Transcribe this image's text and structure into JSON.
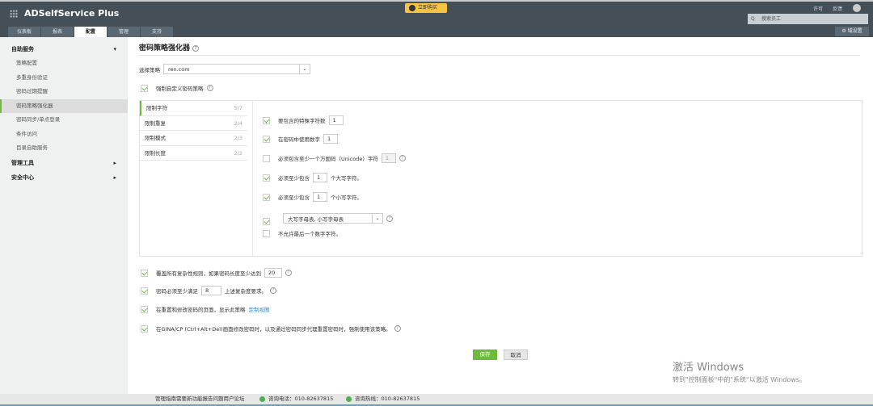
{
  "header": {
    "app_name": "ADSelfService Plus",
    "buy_now": "立即购买",
    "license": "许可",
    "feedback": "反馈",
    "search_placeholder": "搜索员工",
    "domain_settings": "域设置",
    "tabs": [
      {
        "label": "仪表板"
      },
      {
        "label": "报表"
      },
      {
        "label": "配置"
      },
      {
        "label": "管理"
      },
      {
        "label": "支持"
      }
    ],
    "active_tab": "配置"
  },
  "sidebar": {
    "sections": [
      {
        "label": "自助服务",
        "items": [
          "策略配置",
          "多重身份验证",
          "密码过期提醒",
          "密码策略强化器",
          "密码同步/单点登录",
          "条件访问",
          "目录自助服务"
        ]
      },
      {
        "label": "管理工具"
      },
      {
        "label": "安全中心"
      }
    ],
    "active_item": "密码策略强化器"
  },
  "main": {
    "title": "密码策略强化器",
    "select_policy_label": "选择策略",
    "policy_value": "ren.com",
    "enforce_custom": "强制自定义密码策略",
    "rule_tabs": [
      {
        "label": "限制字符",
        "count": "5/7"
      },
      {
        "label": "限制重复",
        "count": "2/4"
      },
      {
        "label": "限制模式",
        "count": "2/3"
      },
      {
        "label": "限制长度",
        "count": "2/2"
      }
    ],
    "rules": {
      "special": {
        "label": "要包含的特殊字符数",
        "value": "1",
        "checked": true
      },
      "digit": {
        "label": "在密码中使用数字",
        "value": "1",
        "checked": true
      },
      "unicode": {
        "label": "必须包含至少一个万国码（Unicode）字符",
        "value": "1",
        "checked": false
      },
      "upper": {
        "label": "必须至少包含",
        "value": "1",
        "suffix": "个大写字符。",
        "checked": true
      },
      "lower": {
        "label": "必须至少包含",
        "value": "1",
        "suffix": "个小写字符。",
        "checked": true
      },
      "start_with": {
        "value": "大写字母表, 小写字母表",
        "checked": true
      },
      "last_digit": {
        "label": "不允许最后一个数字字符。",
        "checked": false
      }
    },
    "override": {
      "label": "覆盖所有复杂性规则，如果密码长度至少达到",
      "value": "20"
    },
    "min_meet": {
      "label": "密码必须至少满足",
      "value": "8",
      "suffix": "上述复杂度要求。"
    },
    "display": {
      "label": "在重置和修改密码的页面，显示此策略",
      "link": "定制视图"
    },
    "gina": {
      "label": "在GINA/CP (Ctrl+Alt+Del)画面修改密码时，以及通过密码同步代理重置密码时，强制使用该策略。"
    },
    "save": "保存",
    "cancel": "取消"
  },
  "footer": {
    "links": "管理指南需要新功能报告问题用户论坛",
    "phone": "咨询电话：010-82637815",
    "hotline": "咨询热线：010-82637815"
  },
  "watermark": {
    "line1": "激活 Windows",
    "line2": "转到\"控制面板\"中的\"系统\"以激活 Windows。"
  },
  "colors": {
    "header": "#444f58",
    "accent": "#6dbb3a",
    "buy": "#f6c342"
  }
}
